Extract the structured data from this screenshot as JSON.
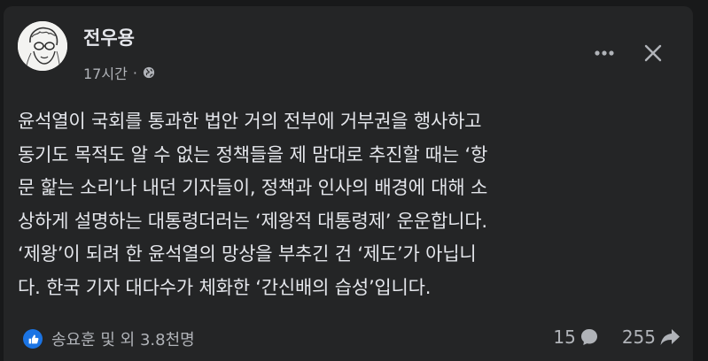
{
  "post": {
    "author": "전우용",
    "time": "17시간",
    "separator": "·",
    "lines": [
      "윤석열이 국회를 통과한 법안 거의 전부에 거부권을 행사하고",
      "동기도 목적도 알 수 없는 정책들을 제 맘대로 추진할 때는 ‘항",
      "문 핥는 소리’나 내던 기자들이, 정책과 인사의 배경에 대해 소",
      "상하게 설명하는 대통령더러는 ‘제왕적 대통령제’ 운운합니다.",
      "‘제왕’이 되려 한 윤석열의 망상을 부추긴 건 ‘제도’가 아닙니",
      "다. 한국 기자 대다수가 체화한 ‘간신배의 습성’입니다."
    ],
    "reactions_text": "송요훈 및 외 3.8천명",
    "comments_count": "15",
    "shares_count": "255"
  },
  "colors": {
    "background": "#18191a",
    "card": "#242526",
    "text": "#e4e6eb",
    "secondary": "#b0b3b8",
    "like_blue": "#1b74e4"
  },
  "icons": {
    "privacy": "globe-icon",
    "more": "more-horizontal-icon",
    "close": "close-icon",
    "like": "thumbs-up-icon",
    "comment": "comment-icon",
    "share": "share-icon"
  }
}
